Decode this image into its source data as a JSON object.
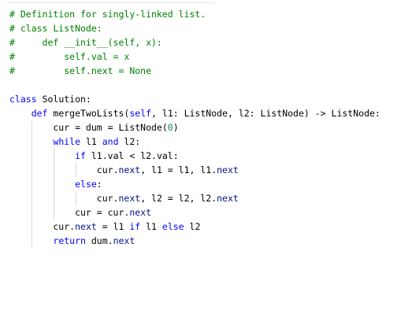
{
  "editor": {
    "lines": [
      [
        {
          "t": "# Definition for singly-linked list.",
          "c": "comment"
        }
      ],
      [
        {
          "t": "# class ListNode:",
          "c": "comment"
        }
      ],
      [
        {
          "t": "#     def __init__(self, x):",
          "c": "comment"
        }
      ],
      [
        {
          "t": "#         self.val = x",
          "c": "comment"
        }
      ],
      [
        {
          "t": "#         self.next = None",
          "c": "comment"
        }
      ],
      [],
      [
        {
          "t": "class",
          "c": "kw"
        },
        {
          "t": " Solution:",
          "c": "plain"
        }
      ],
      [
        {
          "t": "    ",
          "c": "plain"
        },
        {
          "t": "def",
          "c": "kw"
        },
        {
          "t": " mergeTwoLists(",
          "c": "plain"
        },
        {
          "t": "self",
          "c": "kw"
        },
        {
          "t": ", l1: ListNode, l2: ListNode) -> ListNode:",
          "c": "plain"
        }
      ],
      [
        {
          "t": "        cur = dum = ListNode(",
          "c": "plain"
        },
        {
          "t": "0",
          "c": "num"
        },
        {
          "t": ")",
          "c": "plain"
        }
      ],
      [
        {
          "t": "        ",
          "c": "plain"
        },
        {
          "t": "while",
          "c": "kw"
        },
        {
          "t": " l1 ",
          "c": "plain"
        },
        {
          "t": "and",
          "c": "kw"
        },
        {
          "t": " l2:",
          "c": "plain"
        }
      ],
      [
        {
          "t": "            ",
          "c": "plain"
        },
        {
          "t": "if",
          "c": "kw"
        },
        {
          "t": " l1.val < l2.val:",
          "c": "plain"
        }
      ],
      [
        {
          "t": "                cur.",
          "c": "plain"
        },
        {
          "t": "next",
          "c": "prop"
        },
        {
          "t": ", l1 = l1, l1.",
          "c": "plain"
        },
        {
          "t": "next",
          "c": "prop"
        }
      ],
      [
        {
          "t": "            ",
          "c": "plain"
        },
        {
          "t": "else",
          "c": "kw"
        },
        {
          "t": ":",
          "c": "plain"
        }
      ],
      [
        {
          "t": "                cur.",
          "c": "plain"
        },
        {
          "t": "next",
          "c": "prop"
        },
        {
          "t": ", l2 = l2, l2.",
          "c": "plain"
        },
        {
          "t": "next",
          "c": "prop"
        }
      ],
      [
        {
          "t": "            cur = cur.",
          "c": "plain"
        },
        {
          "t": "next",
          "c": "prop"
        }
      ],
      [
        {
          "t": "        cur.",
          "c": "plain"
        },
        {
          "t": "next",
          "c": "prop"
        },
        {
          "t": " = l1 ",
          "c": "plain"
        },
        {
          "t": "if",
          "c": "kw"
        },
        {
          "t": " l1 ",
          "c": "plain"
        },
        {
          "t": "else",
          "c": "kw"
        },
        {
          "t": " l2",
          "c": "plain"
        }
      ],
      [
        {
          "t": "        ",
          "c": "plain"
        },
        {
          "t": "return",
          "c": "kw"
        },
        {
          "t": " dum.",
          "c": "plain"
        },
        {
          "t": "next",
          "c": "prop"
        }
      ]
    ]
  },
  "colors": {
    "comment": "#008000",
    "keyword": "#0000ff",
    "number": "#098658",
    "property": "#001080",
    "text": "#000000",
    "indent_guide": "#d8d8d8"
  }
}
